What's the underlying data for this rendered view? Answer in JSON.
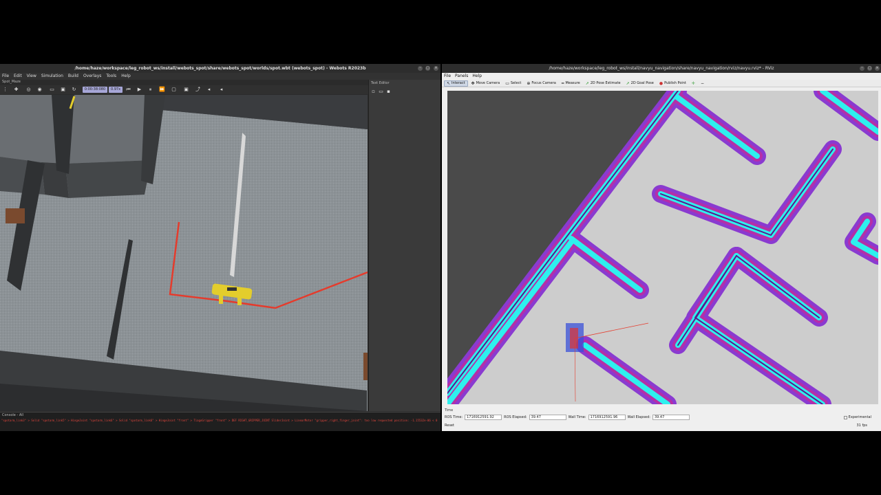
{
  "webots": {
    "title": "/home/haze/workspace/leg_robot_ws/install/webots_spot/share/webots_spot/worlds/spot.wbt (webots_spot) - Webots R2023b",
    "menu": [
      "File",
      "Edit",
      "View",
      "Simulation",
      "Build",
      "Overlays",
      "Tools",
      "Help"
    ],
    "tree_label": "Spot_Maze",
    "sim_time": "0:00:38:080",
    "speed": "0.97x",
    "text_editor_title": "Text Editor",
    "console_title": "Console - All",
    "console_line": "\"spotarm_link3\" > Solid \"spotarm_link5\" > HingeJoint \"spotarm_link6\" > Solid \"spotarm_link6\" > HingeJoint \"front\" > TiagoGripper \"front\" > DEF RIGHT_GRIPPER_JOINT SliderJoint > LinearMotor \"gripper_right_finger_joint\": too low requested position: -1.15532e-06 < 0"
  },
  "rviz": {
    "title": "/home/haze/workspace/leg_robot_ws/install/navyu_navigation/share/navyu_navigation/rviz/navyu.rviz* - RViz",
    "menu": [
      "File",
      "Panels",
      "Help"
    ],
    "tools": [
      {
        "label": "Interact",
        "icon": "cursor-icon",
        "glyph": "↖",
        "active": true
      },
      {
        "label": "Move Camera",
        "icon": "move-camera-icon",
        "glyph": "✥",
        "active": false
      },
      {
        "label": "Select",
        "icon": "select-icon",
        "glyph": "▭",
        "active": false
      },
      {
        "label": "Focus Camera",
        "icon": "focus-icon",
        "glyph": "⊕",
        "active": false
      },
      {
        "label": "Measure",
        "icon": "ruler-icon",
        "glyph": "━",
        "active": false
      },
      {
        "label": "2D Pose Estimate",
        "icon": "pose-estimate-icon",
        "glyph": "➚",
        "active": false
      },
      {
        "label": "2D Goal Pose",
        "icon": "goal-pose-icon",
        "glyph": "➚",
        "active": false
      },
      {
        "label": "Publish Point",
        "icon": "pin-icon",
        "glyph": "📍",
        "active": false
      }
    ],
    "time_panel": {
      "header": "Time",
      "ros_time_label": "ROS Time:",
      "ros_time": "1716912591.92",
      "ros_elapsed_label": "ROS Elapsed:",
      "ros_elapsed": "39.47",
      "wall_time_label": "Wall Time:",
      "wall_time": "1716912591.96",
      "wall_elapsed_label": "Wall Elapsed:",
      "wall_elapsed": "39.47",
      "experimental": "Experimental",
      "reset": "Reset",
      "fps": "31 fps"
    }
  },
  "colors": {
    "costmap_cyan": "#2ef0ee",
    "costmap_purple": "#8a3ad0",
    "costmap_magenta": "#b52fa6",
    "laser_red": "#e53b2c",
    "robot_yellow": "#e3cd2c"
  }
}
